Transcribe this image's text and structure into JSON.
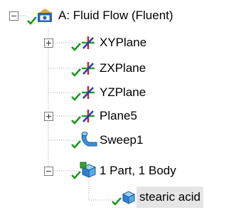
{
  "tree": {
    "root": {
      "label": "A: Fluid Flow (Fluent)",
      "expanded": true
    },
    "items": [
      {
        "label": "XYPlane",
        "icon": "coordinate-plane-icon",
        "has_children": true,
        "expanded": false
      },
      {
        "label": "ZXPlane",
        "icon": "coordinate-plane-icon",
        "has_children": false
      },
      {
        "label": "YZPlane",
        "icon": "coordinate-plane-icon",
        "has_children": false
      },
      {
        "label": "Plane5",
        "icon": "coordinate-plane-icon",
        "has_children": true,
        "expanded": false
      },
      {
        "label": "Sweep1",
        "icon": "sweep-feature-icon",
        "has_children": false
      },
      {
        "label": "1 Part, 1 Body",
        "icon": "parts-cube-icon",
        "has_children": true,
        "expanded": true
      },
      {
        "label": "stearic acid",
        "icon": "body-cube-icon",
        "has_children": false,
        "selected": true
      }
    ]
  }
}
